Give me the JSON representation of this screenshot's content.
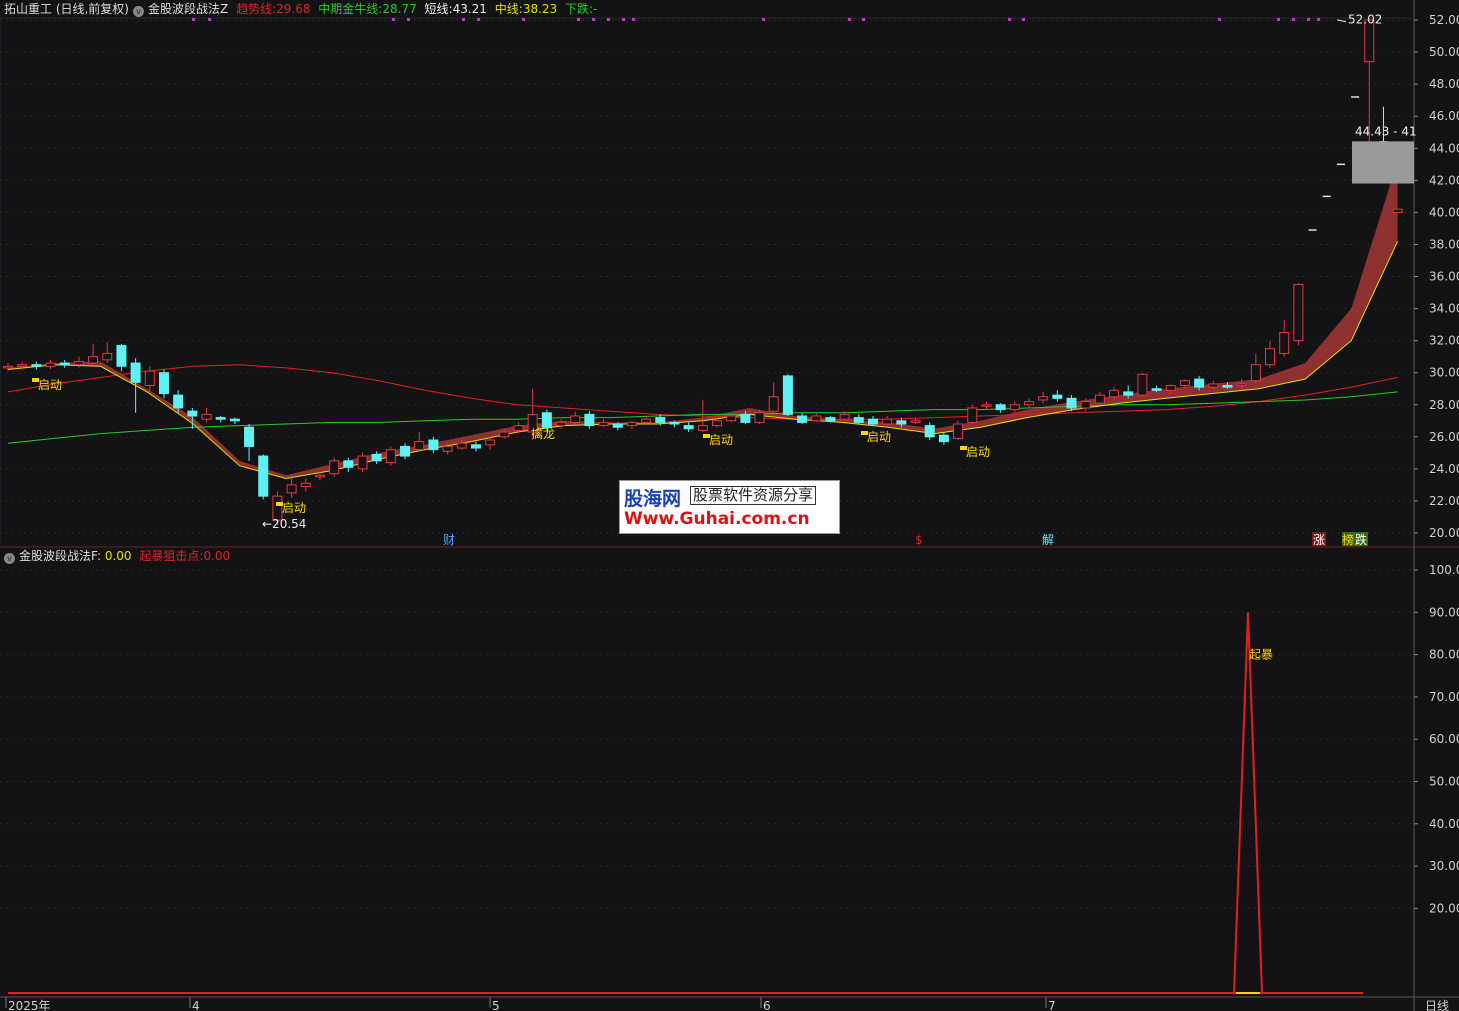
{
  "header": {
    "stock": "拓山重工 (日线,前复权)",
    "indicator": "金股波段战法Z",
    "trend": {
      "label": "趋势线:",
      "value": "29.68"
    },
    "mid_bull": {
      "label": "中期金牛线:",
      "value": "28.77"
    },
    "short": {
      "label": "短线:",
      "value": "43.21"
    },
    "mid": {
      "label": "中线:",
      "value": "38.23"
    },
    "fall": {
      "label": "下跌:",
      "value": "-"
    }
  },
  "sub_header": {
    "indicator": "金股波段战法F",
    "f_value": ": 0.00",
    "surge": {
      "label": "起暴狙击点:",
      "value": "0.00"
    }
  },
  "price_axis": [
    "52.00",
    "50.00",
    "48.00",
    "46.00",
    "44.00",
    "42.00",
    "40.00",
    "38.00",
    "36.00",
    "34.00",
    "32.00",
    "30.00",
    "28.00",
    "26.00",
    "24.00",
    "22.00",
    "20.00"
  ],
  "sub_axis": [
    "100.0",
    "90.00",
    "80.00",
    "70.00",
    "60.00",
    "50.00",
    "40.00",
    "30.00",
    "20.00"
  ],
  "x_axis": [
    "2025年",
    "4",
    "5",
    "6",
    "7"
  ],
  "period": "日线",
  "annotations": {
    "high": "52.02",
    "low": "←20.54",
    "range": "44.43 - 41",
    "start": "启动",
    "trend_ok": "擒龙",
    "surge": "起暴",
    "ev_cai": "财",
    "ev_dollar": "$",
    "ev_jie": "解",
    "ev_zhang": "涨",
    "ev_bang": "榜",
    "ev_die": "跌"
  },
  "watermark": {
    "brand": "股海网",
    "tag": "股票软件资源分享",
    "url": "Www.Guhai.com.cn"
  },
  "colors": {
    "up": "#e8353d",
    "down": "#5ff2f5",
    "trend": "#e02020",
    "bull": "#22cc22",
    "short": "#e0e000",
    "band": "#9c3333",
    "bg": "#131316",
    "purple": "#d030d0"
  },
  "chart_data": [
    {
      "type": "candlestick",
      "title": "金股波段战法Z",
      "ylim": [
        20,
        53
      ],
      "grid": true,
      "series_names": [
        "趋势线",
        "中期金牛线",
        "短线",
        "中线"
      ],
      "candles": [
        [
          30.3,
          30.4,
          30.6,
          30.1
        ],
        [
          30.4,
          30.5,
          30.7,
          30.2
        ],
        [
          30.5,
          30.4,
          30.7,
          30.2
        ],
        [
          30.4,
          30.6,
          30.8,
          30.2
        ],
        [
          30.6,
          30.5,
          30.8,
          30.3
        ],
        [
          30.5,
          30.7,
          31.0,
          30.3
        ],
        [
          30.6,
          31.0,
          31.8,
          30.5
        ],
        [
          30.8,
          31.2,
          31.9,
          30.6
        ],
        [
          31.7,
          30.4,
          31.8,
          30.1
        ],
        [
          30.6,
          29.4,
          30.9,
          27.5
        ],
        [
          29.2,
          30.1,
          30.4,
          28.8
        ],
        [
          30.0,
          28.7,
          30.2,
          28.4
        ],
        [
          28.6,
          27.8,
          28.9,
          27.5
        ],
        [
          27.6,
          27.3,
          27.8,
          26.5
        ],
        [
          27.1,
          27.4,
          27.8,
          26.9
        ],
        [
          27.2,
          27.1,
          27.3,
          26.9
        ],
        [
          27.1,
          27.0,
          27.2,
          26.8
        ],
        [
          26.6,
          25.4,
          26.8,
          24.5
        ],
        [
          24.8,
          22.3,
          24.9,
          22.1
        ],
        [
          20.8,
          22.3,
          22.6,
          20.5
        ],
        [
          22.5,
          23.0,
          23.6,
          22.2
        ],
        [
          22.9,
          23.1,
          23.4,
          22.6
        ],
        [
          23.5,
          23.6,
          23.8,
          23.3
        ],
        [
          23.7,
          24.5,
          24.7,
          23.5
        ],
        [
          24.5,
          24.1,
          24.7,
          23.8
        ],
        [
          24.0,
          24.8,
          25.0,
          23.8
        ],
        [
          24.9,
          24.5,
          25.1,
          24.3
        ],
        [
          24.4,
          25.2,
          25.4,
          24.2
        ],
        [
          25.4,
          24.8,
          25.6,
          24.6
        ],
        [
          25.2,
          25.7,
          26.3,
          25.1
        ],
        [
          25.8,
          25.2,
          26.0,
          25.0
        ],
        [
          25.1,
          25.4,
          25.6,
          24.9
        ],
        [
          25.3,
          25.6,
          25.8,
          25.2
        ],
        [
          25.5,
          25.3,
          25.7,
          25.1
        ],
        [
          25.5,
          25.8,
          26.0,
          25.2
        ],
        [
          26.0,
          26.3,
          26.5,
          25.9
        ],
        [
          26.4,
          26.7,
          26.9,
          26.2
        ],
        [
          26.3,
          27.4,
          29.0,
          26.0
        ],
        [
          27.5,
          26.6,
          27.7,
          26.4
        ],
        [
          26.7,
          26.9,
          27.1,
          26.5
        ],
        [
          26.9,
          27.3,
          27.6,
          26.8
        ],
        [
          27.4,
          26.7,
          27.6,
          26.5
        ],
        [
          26.7,
          26.9,
          27.1,
          26.6
        ],
        [
          26.8,
          26.6,
          26.9,
          26.4
        ],
        [
          26.7,
          26.9,
          27.0,
          26.5
        ],
        [
          26.9,
          27.1,
          27.3,
          26.8
        ],
        [
          27.2,
          26.9,
          27.4,
          26.7
        ],
        [
          26.9,
          26.8,
          27.0,
          26.6
        ],
        [
          26.7,
          26.5,
          26.9,
          26.3
        ],
        [
          26.4,
          26.7,
          28.3,
          26.3
        ],
        [
          26.7,
          27.0,
          27.2,
          26.6
        ],
        [
          27.0,
          27.3,
          27.5,
          26.9
        ],
        [
          27.4,
          26.9,
          27.6,
          26.8
        ],
        [
          26.9,
          27.5,
          27.7,
          26.8
        ],
        [
          27.6,
          28.5,
          29.4,
          27.5
        ],
        [
          29.8,
          27.4,
          29.9,
          27.3
        ],
        [
          27.3,
          26.9,
          27.5,
          26.8
        ],
        [
          27.0,
          27.3,
          27.5,
          26.9
        ],
        [
          27.2,
          27.0,
          27.3,
          26.9
        ],
        [
          27.1,
          27.4,
          27.6,
          27.0
        ],
        [
          27.2,
          26.9,
          27.4,
          26.8
        ],
        [
          27.1,
          26.8,
          27.3,
          26.7
        ],
        [
          26.8,
          27.1,
          27.3,
          26.7
        ],
        [
          27.0,
          26.8,
          27.2,
          26.6
        ],
        [
          26.9,
          27.0,
          27.2,
          26.8
        ],
        [
          26.7,
          26.0,
          26.9,
          25.8
        ],
        [
          26.1,
          25.7,
          26.3,
          25.5
        ],
        [
          25.9,
          26.8,
          27.0,
          25.8
        ],
        [
          26.9,
          27.8,
          28.0,
          26.8
        ],
        [
          27.9,
          28.0,
          28.2,
          27.7
        ],
        [
          28.0,
          27.7,
          28.1,
          27.5
        ],
        [
          27.7,
          28.0,
          28.2,
          27.5
        ],
        [
          28.0,
          28.2,
          28.4,
          27.8
        ],
        [
          28.3,
          28.5,
          28.8,
          28.1
        ],
        [
          28.6,
          28.4,
          28.9,
          28.2
        ],
        [
          28.4,
          27.8,
          28.6,
          27.6
        ],
        [
          27.8,
          28.2,
          28.4,
          27.6
        ],
        [
          28.1,
          28.6,
          28.8,
          28.0
        ],
        [
          28.5,
          28.9,
          29.1,
          28.3
        ],
        [
          28.8,
          28.6,
          29.2,
          28.4
        ],
        [
          28.6,
          29.9,
          30.0,
          28.5
        ],
        [
          29.0,
          28.9,
          29.2,
          28.8
        ],
        [
          28.9,
          29.2,
          29.3,
          28.7
        ],
        [
          29.2,
          29.5,
          29.6,
          29.0
        ],
        [
          29.6,
          29.1,
          29.8,
          28.9
        ],
        [
          29.1,
          29.3,
          29.5,
          29.0
        ],
        [
          29.2,
          29.1,
          29.4,
          29.0
        ],
        [
          29.2,
          29.3,
          29.6,
          28.9
        ],
        [
          29.5,
          30.5,
          31.2,
          29.3
        ],
        [
          30.5,
          31.5,
          32.0,
          30.3
        ],
        [
          31.2,
          32.5,
          33.3,
          31.0
        ],
        [
          32.0,
          35.5,
          35.6,
          31.7
        ],
        [
          38.9,
          null,
          null,
          null
        ],
        [
          41.0,
          null,
          null,
          null
        ],
        [
          43.0,
          null,
          null,
          null
        ],
        [
          47.2,
          null,
          null,
          null
        ],
        [
          49.4,
          52.0,
          52.1,
          42.6
        ],
        [
          44.4,
          null,
          46.6,
          null
        ],
        [
          40.0,
          40.2,
          null,
          null
        ]
      ],
      "trend_line": [
        28.8,
        29.3,
        29.7,
        30.1,
        30.4,
        30.5,
        30.3,
        30.0,
        29.5,
        28.9,
        28.4,
        28.0,
        27.8,
        27.6,
        27.4,
        27.3,
        27.2,
        27.1,
        27.1,
        27.1,
        27.2,
        27.3,
        27.4,
        27.5,
        27.6,
        27.7,
        27.9,
        28.2,
        28.6,
        29.1,
        29.7
      ],
      "bull_line": [
        25.6,
        25.9,
        26.2,
        26.4,
        26.6,
        26.7,
        26.8,
        26.9,
        26.9,
        27.0,
        27.1,
        27.1,
        27.2,
        27.2,
        27.3,
        27.4,
        27.4,
        27.5,
        27.5,
        27.6,
        27.7,
        27.7,
        27.8,
        27.9,
        28.0,
        28.0,
        28.1,
        28.2,
        28.3,
        28.5,
        28.8
      ],
      "short_line": [
        30.3,
        30.6,
        30.7,
        29.0,
        27.2,
        24.5,
        23.6,
        24.3,
        25.0,
        25.5,
        26.1,
        26.7,
        27.0,
        26.9,
        26.9,
        27.2,
        27.8,
        27.3,
        27.1,
        26.9,
        26.5,
        27.0,
        27.7,
        28.2,
        28.6,
        29.0,
        29.3,
        29.6,
        30.6,
        34.0,
        43.2
      ],
      "mid_line": [
        30.2,
        30.5,
        30.4,
        28.8,
        26.8,
        24.2,
        23.4,
        23.9,
        24.6,
        25.2,
        25.7,
        26.3,
        26.7,
        26.8,
        26.8,
        27.0,
        27.4,
        27.1,
        26.9,
        26.6,
        26.2,
        26.6,
        27.2,
        27.7,
        28.1,
        28.4,
        28.7,
        29.0,
        29.6,
        32.0,
        38.2
      ]
    },
    {
      "type": "line",
      "title": "金股波段战法F",
      "ylim": [
        0,
        100
      ],
      "series_names": [
        "起暴狙击点"
      ],
      "baseline": 0,
      "spike": {
        "value": 90,
        "label": "起暴"
      }
    }
  ]
}
